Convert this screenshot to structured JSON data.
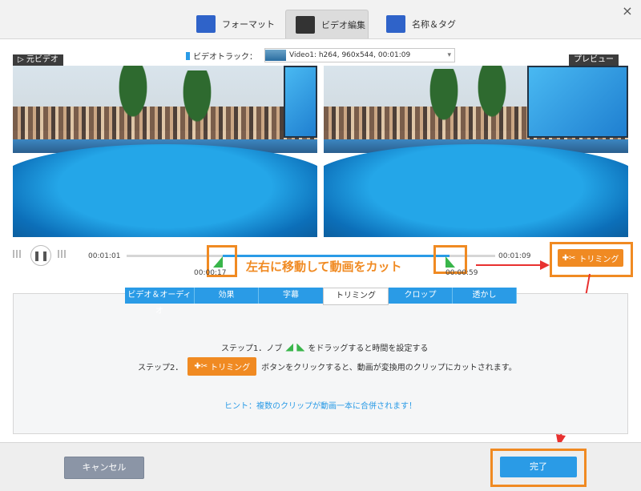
{
  "window": {
    "close_icon": "×"
  },
  "tabs": [
    {
      "label": "フォーマット"
    },
    {
      "label": "ビデオ編集"
    },
    {
      "label": "名称＆タグ"
    }
  ],
  "video_track": {
    "label": "ビデオトラック：",
    "value": "Video1: h264, 960x544, 00:01:09"
  },
  "panes": {
    "original_label": "元ビデオ",
    "preview_label": "プレビュー"
  },
  "player": {
    "current_time": "00:01:01",
    "end_time": "00:01:09",
    "start_marker": "00:00:17",
    "end_marker": "00:00:59"
  },
  "annotation": {
    "instruction": "左右に移動して動画をカット"
  },
  "trim_button": {
    "label": "トリミング"
  },
  "subtabs": [
    "ビデオ＆オーディオ",
    "効果",
    "字幕",
    "トリミング",
    "クロップ",
    "透かし"
  ],
  "steps": {
    "step1_pre": "ステップ1．ノブ",
    "step1_post": "をドラッグすると時間を設定する",
    "step2_pre": "ステップ2．",
    "step2_button": "トリミング",
    "step2_post": "ボタンをクリックすると、動画が変換用のクリップにカットされます。"
  },
  "hint": "ヒント：複数のクリップが動画一本に合併されます！",
  "footer": {
    "cancel_label": "キャンセル",
    "done_label": "完了"
  },
  "colors": {
    "accent_blue": "#2a9be6",
    "annotation_orange": "#f08a22",
    "handle_green": "#39b54a"
  }
}
